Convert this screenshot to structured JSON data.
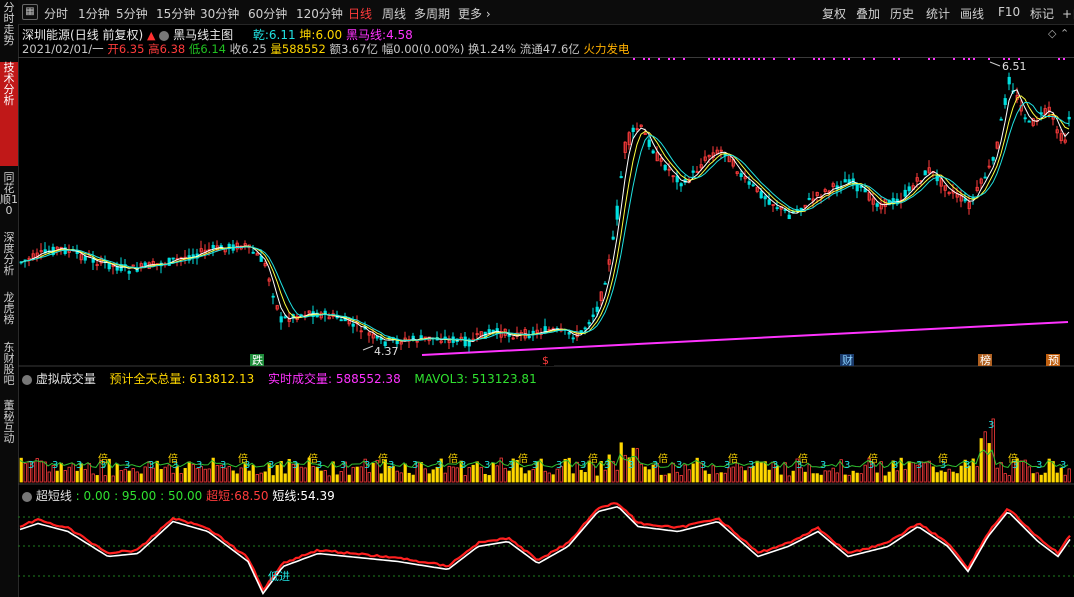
{
  "sidebar": [
    {
      "label": "分时走势",
      "active": false
    },
    {
      "label": "技术分析",
      "active": true
    },
    {
      "label": "同花顺10",
      "active": false
    },
    {
      "label": "深度分析",
      "active": false
    },
    {
      "label": "龙虎榜",
      "active": false
    },
    {
      "label": "东财股吧",
      "active": false
    },
    {
      "label": "董秘互动",
      "active": false
    }
  ],
  "periods": [
    "分时",
    "1分钟",
    "5分钟",
    "15分钟",
    "30分钟",
    "60分钟",
    "120分钟",
    "日线",
    "周线",
    "多周期",
    "更多"
  ],
  "active_period": "日线",
  "right_menu": [
    "复权",
    "叠加",
    "历史",
    "统计",
    "画线",
    "F10",
    "标记",
    "+自"
  ],
  "header": {
    "stock_name": "深圳能源",
    "mode": "(日线 前复权)",
    "indicator_name": "黑马线主图",
    "qian_label": "乾:",
    "qian_value": "6.11",
    "kun_label": "坤:",
    "kun_value": "6.00",
    "heima_label": "黑马线:",
    "heima_value": "4.58"
  },
  "quote": {
    "date": "2021/02/01/一",
    "open_label": "开",
    "open": "6.35",
    "high_label": "高",
    "high": "6.38",
    "low_label": "低",
    "low": "6.14",
    "close_label": "收",
    "close": "6.25",
    "vol_label": "量",
    "volume": "588552",
    "amount_label": "额",
    "amount": "3.67亿",
    "change_label": "幅",
    "change": "0.00(0.00%)",
    "turnover_label": "换",
    "turnover": "1.24%",
    "float_label": "流通",
    "float_cap": "47.6亿",
    "sector": "火力发电"
  },
  "price_labels": {
    "high": "6.51",
    "low": "4.37"
  },
  "markers": [
    "跌",
    "$",
    "财",
    "榜",
    "预"
  ],
  "volume_panel": {
    "title": "虚拟成交量",
    "forecast_label": "预计全天总量:",
    "forecast": "613812.13",
    "realtime_label": "实时成交量:",
    "realtime": "588552.38",
    "mavol_label": "MAVOL3:",
    "mavol": "513123.81",
    "badge_text": "倍"
  },
  "osc_panel": {
    "title": "超短线",
    "levels": ": 0.00 : 95.00 : 50.00",
    "super_label": "超短:",
    "super_value": "68.50",
    "short_label": "短线:",
    "short_value": "54.39",
    "signal_text": "低进"
  },
  "colors": {
    "up": "#ff3c3c",
    "down": "#00e0e0",
    "magenta": "#ff33ff",
    "yellow": "#ffd700",
    "white": "#ffffff"
  }
}
